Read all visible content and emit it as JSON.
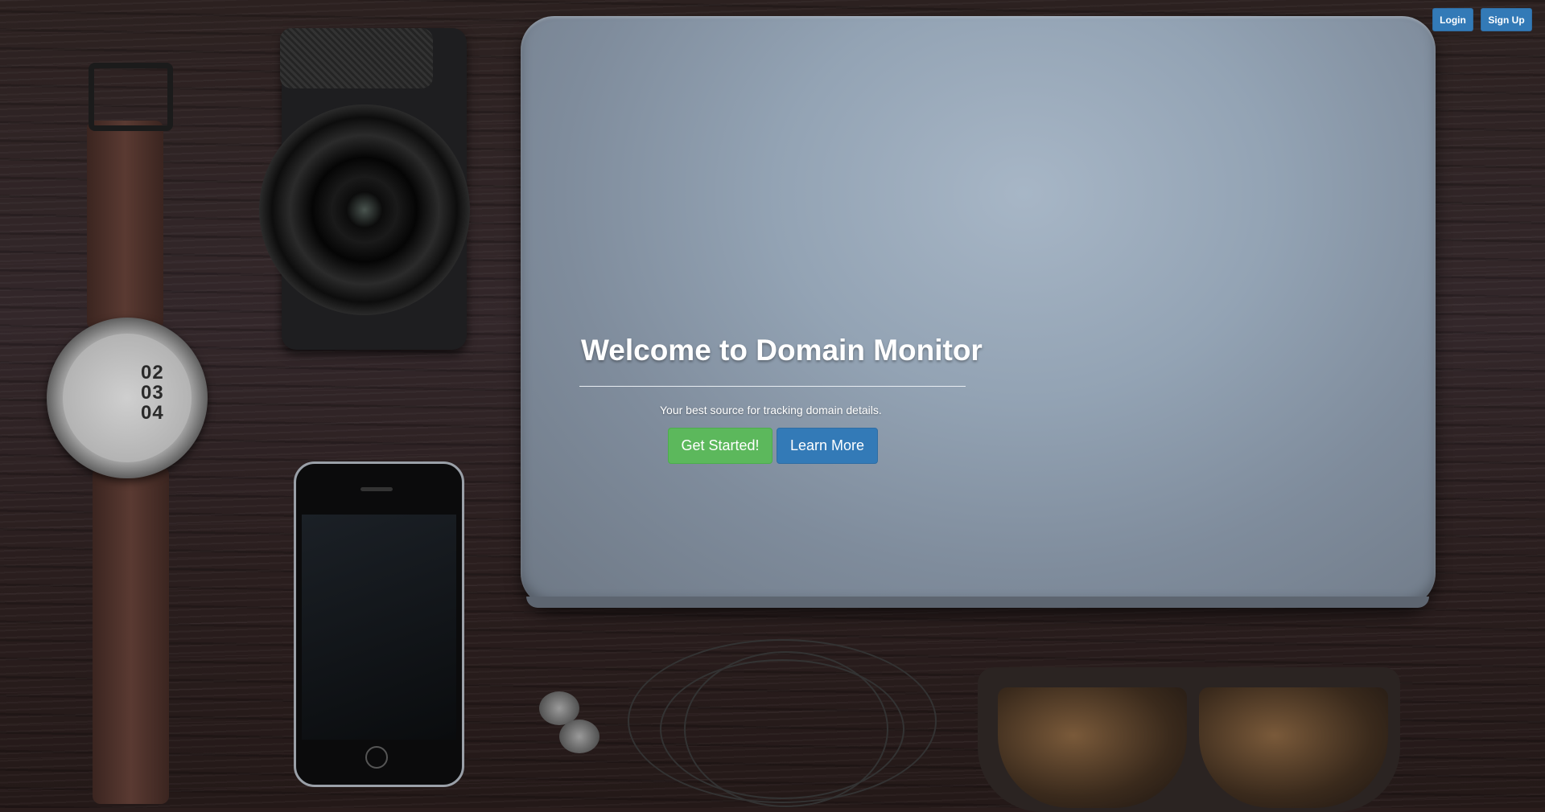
{
  "nav": {
    "login_label": "Login",
    "signup_label": "Sign Up"
  },
  "hero": {
    "title": "Welcome to Domain Monitor",
    "subtitle": "Your best source for tracking domain details.",
    "get_started_label": "Get Started!",
    "learn_more_label": "Learn More"
  },
  "background": {
    "watch_numbers": [
      "02",
      "03",
      "04"
    ]
  },
  "colors": {
    "primary": "#337ab7",
    "success": "#5cb85c"
  }
}
